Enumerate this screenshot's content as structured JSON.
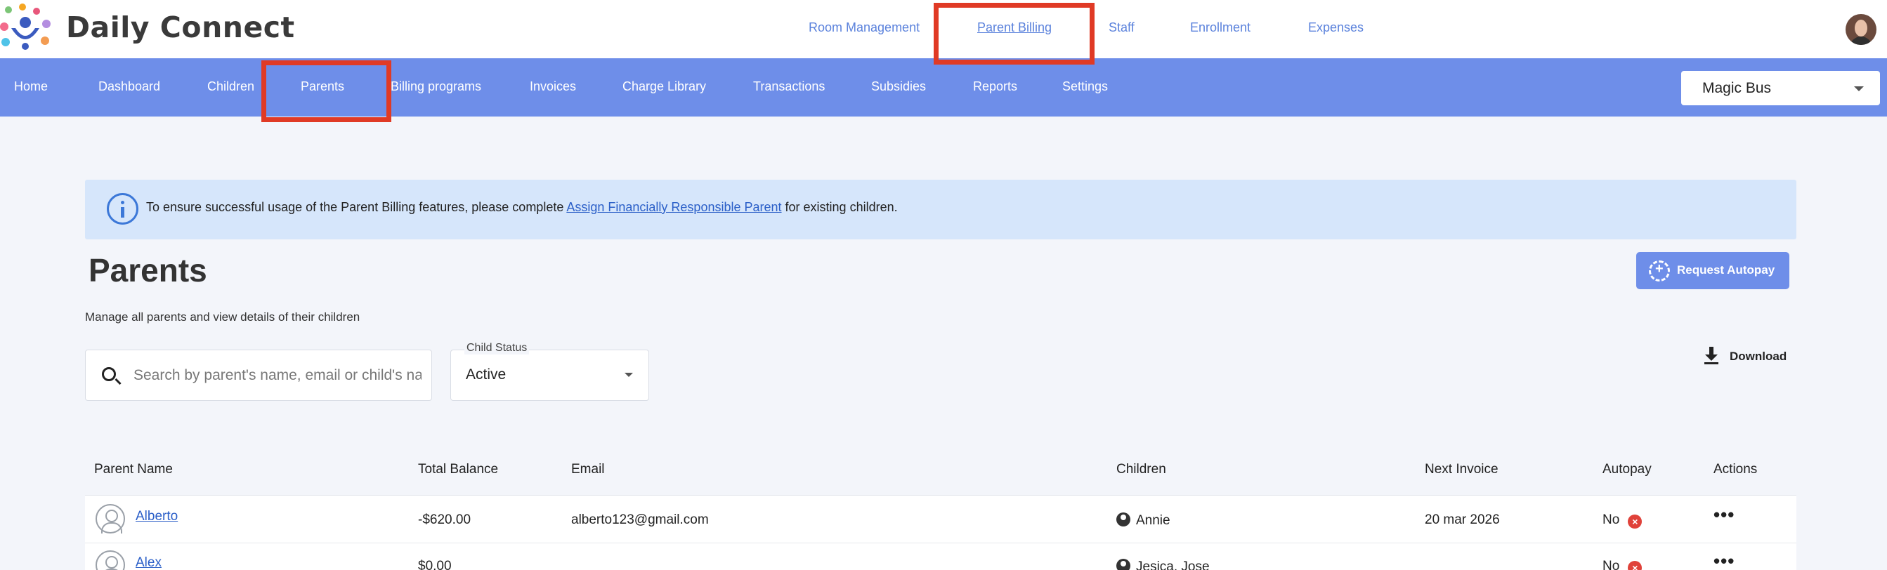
{
  "app": {
    "brand": "Daily Connect"
  },
  "top_nav": [
    {
      "label": "Room Management"
    },
    {
      "label": "Parent Billing",
      "active": true
    },
    {
      "label": "Staff"
    },
    {
      "label": "Enrollment"
    },
    {
      "label": "Expenses"
    }
  ],
  "sub_nav": [
    {
      "label": "Home"
    },
    {
      "label": "Dashboard"
    },
    {
      "label": "Children"
    },
    {
      "label": "Parents",
      "active": true
    },
    {
      "label": "Billing programs"
    },
    {
      "label": "Invoices"
    },
    {
      "label": "Charge Library"
    },
    {
      "label": "Transactions"
    },
    {
      "label": "Subsidies"
    },
    {
      "label": "Reports"
    },
    {
      "label": "Settings"
    }
  ],
  "site_selector": {
    "value": "Magic Bus"
  },
  "banner": {
    "text_before": "To ensure successful usage of the Parent Billing features, please complete ",
    "link": "Assign Financially Responsible Parent",
    "text_after": " for existing children."
  },
  "page": {
    "title": "Parents",
    "description": "Manage all parents and view details of their children",
    "request_autopay_label": "Request Autopay",
    "download_label": "Download"
  },
  "search": {
    "placeholder": "Search by parent's name, email or child's name",
    "value": ""
  },
  "child_status": {
    "label": "Child Status",
    "value": "Active"
  },
  "table": {
    "columns": [
      "Parent Name",
      "Total Balance",
      "Email",
      "Children",
      "Next Invoice",
      "Autopay",
      "Actions"
    ],
    "rows": [
      {
        "name": "Alberto",
        "balance": "-$620.00",
        "email": "alberto123@gmail.com",
        "children": "Annie",
        "next_invoice": "20 mar 2026",
        "autopay": "No"
      },
      {
        "name": "Alex",
        "balance": "$0.00",
        "email": "",
        "children": "Jesica, Jose",
        "next_invoice": "",
        "autopay": "No"
      }
    ]
  },
  "colors": {
    "nav_blue": "#6e8ee9",
    "highlight_red": "#e03a25",
    "banner_bg": "#d6e6fb",
    "link_blue": "#2b5fc8"
  }
}
